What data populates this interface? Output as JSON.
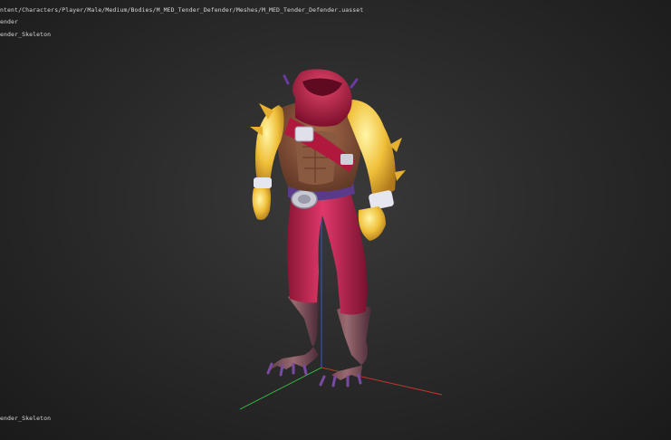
{
  "overlay": {
    "asset_path": "ntent/Characters/Player/Male/Medium/Bodies/M_MED_Tender_Defender/Meshes/M_MED_Tender_Defender.uasset",
    "asset_name": "ender",
    "skeleton_label": "ender_Skeleton",
    "skeleton_label_bottom": "ender_Skeleton"
  },
  "viewport": {
    "model": "headless-character-mesh",
    "axis_colors": {
      "x": "#c0392b",
      "y": "#2ecc40",
      "z": "#3b5bdb"
    }
  },
  "colors": {
    "background": "#2b2b2b",
    "skin": "#f0c03a",
    "pants": "#c8274f",
    "scarf": "#b0183d",
    "vest": "#7a4a35",
    "boots": "#7a4a55"
  }
}
